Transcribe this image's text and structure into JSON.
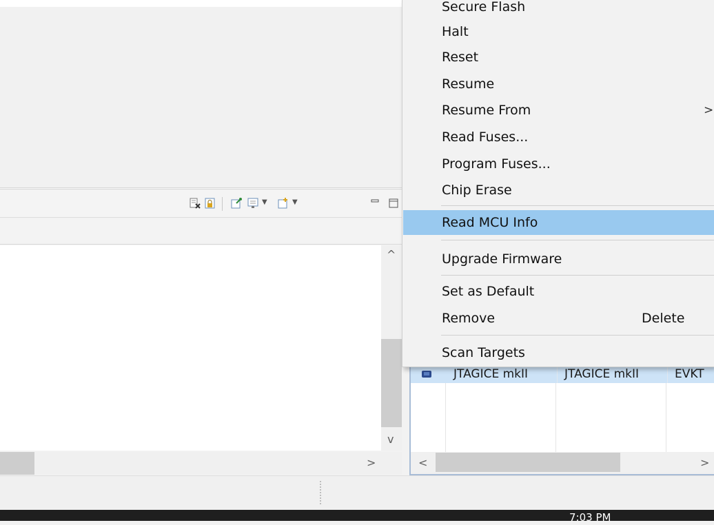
{
  "context_menu": {
    "items": [
      {
        "label": "Secure Flash"
      },
      {
        "label": "Halt"
      },
      {
        "label": "Reset"
      },
      {
        "label": "Resume"
      },
      {
        "label": "Resume From",
        "submenu": ">"
      },
      {
        "label": "Read Fuses..."
      },
      {
        "label": "Program Fuses..."
      },
      {
        "label": "Chip Erase"
      },
      {
        "label": "Read MCU Info",
        "highlighted": true
      },
      {
        "label": "Upgrade Firmware"
      },
      {
        "label": "Set as Default"
      },
      {
        "label": "Remove",
        "shortcut": "Delete"
      },
      {
        "label": "Scan Targets"
      }
    ]
  },
  "targets_table": {
    "row": [
      "JTAGICE mkII",
      "JTAGICE mkII",
      "EVKT"
    ]
  },
  "toolbar_icons": [
    "clear-console-icon",
    "lock-scroll-icon",
    "pin-console-icon",
    "display-console-icon",
    "open-console-icon",
    "minimize-icon",
    "maximize-icon"
  ],
  "scroll_arrows": {
    "up": "^",
    "down": "v",
    "right": ">",
    "left": "<"
  },
  "taskbar": {
    "clock": "7:03 PM"
  },
  "colors": {
    "menu_highlight": "#99c9ef",
    "row_selected": "#cde3f7",
    "taskbar": "#1f1f1f"
  }
}
